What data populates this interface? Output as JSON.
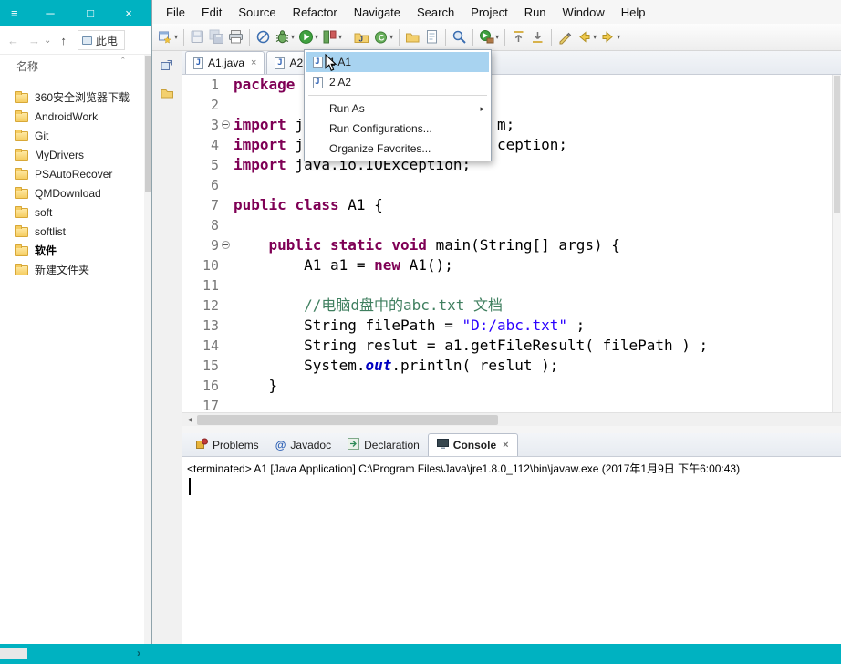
{
  "icons": {
    "menu": "≡",
    "minimize": "─",
    "maximize": "□",
    "close": "×",
    "back": "←",
    "forward": "→",
    "drop": "⌄",
    "up": "↑",
    "sort": "ˆ",
    "submenu": "▸",
    "chevron": "▾",
    "tab_close": "×",
    "hscroll_left": "◂",
    "strip_right": "›"
  },
  "explorer": {
    "breadcrumb": "此电",
    "column_header": "名称",
    "window_controls": [
      {
        "name": "minimize",
        "glyph": "─"
      },
      {
        "name": "maximize",
        "glyph": "□"
      },
      {
        "name": "close",
        "glyph": "×"
      }
    ],
    "nav": [
      {
        "name": "back-arrow",
        "glyph": "←",
        "disabled": true
      },
      {
        "name": "forward-arrow",
        "glyph": "→",
        "disabled": true
      },
      {
        "name": "recent-locations",
        "glyph": "⌄",
        "small": true
      },
      {
        "name": "up-arrow",
        "glyph": "↑",
        "disabled": false
      }
    ],
    "folders": [
      {
        "label": "360安全浏览器下载"
      },
      {
        "label": "AndroidWork"
      },
      {
        "label": "Git"
      },
      {
        "label": "MyDrivers"
      },
      {
        "label": "PSAutoRecover"
      },
      {
        "label": "QMDownload"
      },
      {
        "label": "soft"
      },
      {
        "label": "softlist"
      },
      {
        "label": "软件",
        "bold": true
      },
      {
        "label": "新建文件夹"
      }
    ]
  },
  "eclipse": {
    "menubar": [
      "File",
      "Edit",
      "Source",
      "Refactor",
      "Navigate",
      "Search",
      "Project",
      "Run",
      "Window",
      "Help"
    ],
    "toolbar": [
      {
        "name": "new-wizard",
        "chev": true
      },
      {
        "sep": true
      },
      {
        "name": "save",
        "disabled": true
      },
      {
        "name": "save-all",
        "disabled": true
      },
      {
        "name": "print"
      },
      {
        "sep": true
      },
      {
        "name": "skip-breakpoints"
      },
      {
        "name": "debug",
        "chev": true
      },
      {
        "name": "run",
        "chev": true
      },
      {
        "name": "coverage",
        "chev": true
      },
      {
        "sep": true
      },
      {
        "name": "new-java-project"
      },
      {
        "name": "new-class",
        "chev": true
      },
      {
        "sep": true
      },
      {
        "name": "open-folder"
      },
      {
        "name": "open-resource"
      },
      {
        "sep": true
      },
      {
        "name": "search"
      },
      {
        "sep": true
      },
      {
        "name": "external-tools",
        "chev": true
      },
      {
        "sep": true
      },
      {
        "name": "annotation-prev"
      },
      {
        "name": "annotation-next"
      },
      {
        "sep": true
      },
      {
        "name": "last-edit"
      },
      {
        "name": "back",
        "chev": true
      },
      {
        "name": "forward",
        "chev": true
      }
    ],
    "editor_tabs": [
      {
        "label": "A1.java",
        "icon": "java-file",
        "active": true,
        "closable": true
      },
      {
        "label": "A2",
        "icon": "java-file"
      }
    ],
    "run_menu": {
      "items": [
        {
          "label": "1 A1",
          "icon": "java-app",
          "selected": true
        },
        {
          "label": "2 A2",
          "icon": "java-app"
        },
        {
          "sep": true
        },
        {
          "label": "Run As",
          "submenu": true
        },
        {
          "label": "Run Configurations..."
        },
        {
          "label": "Organize Favorites..."
        }
      ]
    },
    "code": {
      "lines": [
        {
          "n": "1",
          "fold": false,
          "toks": [
            [
              "k",
              "package"
            ],
            [
              "p",
              " "
            ]
          ]
        },
        {
          "n": "2",
          "fold": false,
          "toks": []
        },
        {
          "n": "3",
          "fold": true,
          "toks": [
            [
              "k",
              "import"
            ],
            [
              "p",
              " j                      m;"
            ]
          ]
        },
        {
          "n": "4",
          "fold": false,
          "toks": [
            [
              "k",
              "import"
            ],
            [
              "p",
              " j                      ception;"
            ]
          ]
        },
        {
          "n": "5",
          "fold": false,
          "toks": [
            [
              "k",
              "import"
            ],
            [
              "p",
              " java.io.IOException;"
            ]
          ]
        },
        {
          "n": "6",
          "fold": false,
          "toks": []
        },
        {
          "n": "7",
          "fold": false,
          "toks": [
            [
              "k",
              "public"
            ],
            [
              "p",
              " "
            ],
            [
              "k",
              "class"
            ],
            [
              "p",
              " A1 {"
            ]
          ]
        },
        {
          "n": "8",
          "fold": false,
          "toks": []
        },
        {
          "n": "9",
          "fold": true,
          "toks": [
            [
              "p",
              "    "
            ],
            [
              "k",
              "public"
            ],
            [
              "p",
              " "
            ],
            [
              "k",
              "static"
            ],
            [
              "p",
              " "
            ],
            [
              "k",
              "void"
            ],
            [
              "p",
              " main(String[] args) {"
            ]
          ]
        },
        {
          "n": "10",
          "fold": false,
          "toks": [
            [
              "p",
              "        A1 a1 = "
            ],
            [
              "k",
              "new"
            ],
            [
              "p",
              " A1();"
            ]
          ]
        },
        {
          "n": "11",
          "fold": false,
          "toks": []
        },
        {
          "n": "12",
          "fold": false,
          "toks": [
            [
              "c",
              "        //电脑d盘中的abc.txt 文档"
            ]
          ]
        },
        {
          "n": "13",
          "fold": false,
          "toks": [
            [
              "p",
              "        String filePath = "
            ],
            [
              "s",
              "\"D:/abc.txt\""
            ],
            [
              "p",
              " ;"
            ]
          ]
        },
        {
          "n": "14",
          "fold": false,
          "toks": [
            [
              "p",
              "        String reslut = a1.getFileResult( filePath ) ;"
            ]
          ]
        },
        {
          "n": "15",
          "fold": false,
          "toks": [
            [
              "p",
              "        System."
            ],
            [
              "f",
              "out"
            ],
            [
              "p",
              ".println( reslut );"
            ]
          ]
        },
        {
          "n": "16",
          "fold": false,
          "toks": [
            [
              "p",
              "    }"
            ]
          ]
        },
        {
          "n": "17",
          "fold": false,
          "toks": []
        }
      ]
    },
    "bottom_tabs": [
      {
        "label": "Problems",
        "icon": "problems"
      },
      {
        "label": "Javadoc",
        "icon": "javadoc"
      },
      {
        "label": "Declaration",
        "icon": "declaration"
      },
      {
        "label": "Console",
        "icon": "console",
        "active": true,
        "closable": true
      }
    ],
    "console": {
      "status_line": "<terminated> A1 [Java Application] C:\\Program Files\\Java\\jre1.8.0_112\\bin\\javaw.exe (2017年1月9日 下午6:00:43)"
    }
  }
}
